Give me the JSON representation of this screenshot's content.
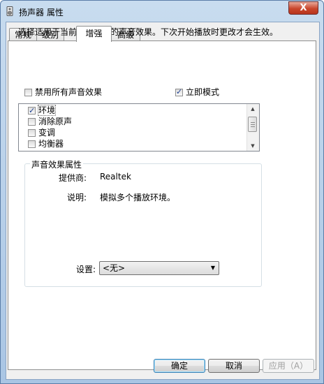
{
  "window": {
    "title": "扬声器 属性",
    "close_glyph": "X"
  },
  "tabs": [
    {
      "label": "常规",
      "active": false
    },
    {
      "label": "级别",
      "active": false
    },
    {
      "label": "增强",
      "active": true
    },
    {
      "label": "高级",
      "active": false
    }
  ],
  "description": "选择适用于当前聆听配置的声音效果。下次开始播放时更改才会生效。",
  "disable_all": {
    "label": "禁用所有声音效果",
    "checked": false
  },
  "immediate_mode": {
    "label": "立即模式",
    "checked": true
  },
  "effects": [
    {
      "label": "环境",
      "checked": true
    },
    {
      "label": "消除原声",
      "checked": false
    },
    {
      "label": "变调",
      "checked": false
    },
    {
      "label": "均衡器",
      "checked": false
    }
  ],
  "properties": {
    "title": "声音效果属性",
    "provider_label": "提供商:",
    "provider_value": "Realtek",
    "desc_label": "说明:",
    "desc_value": "模拟多个播放环境。",
    "setting_label": "设置:",
    "setting_value": "<无>"
  },
  "buttons": {
    "ok": "确定",
    "cancel": "取消",
    "apply": "应用（A）"
  }
}
